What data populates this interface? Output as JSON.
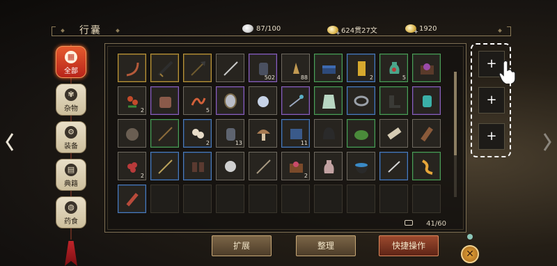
{
  "header": {
    "title": "行囊",
    "resources": [
      {
        "icon": "silver-icon",
        "value": "87/100"
      },
      {
        "icon": "coin-icon",
        "value": "624贯27文"
      },
      {
        "icon": "gold-icon",
        "value": "1920"
      }
    ]
  },
  "tabs": [
    {
      "label": "全部",
      "glyph": "▦",
      "icon": "all-items-icon",
      "active": true
    },
    {
      "label": "杂物",
      "glyph": "✾",
      "icon": "fan-icon",
      "active": false
    },
    {
      "label": "装备",
      "glyph": "⚙",
      "icon": "equipment-icon",
      "active": false
    },
    {
      "label": "典籍",
      "glyph": "▤",
      "icon": "book-icon",
      "active": false
    },
    {
      "label": "药食",
      "glyph": "◍",
      "icon": "food-icon",
      "active": false
    }
  ],
  "inventory": {
    "capacity": "41/60",
    "items": [
      {
        "name": "bow-icon",
        "rarity": "gold",
        "qty": ""
      },
      {
        "name": "saber-icon",
        "rarity": "gold",
        "qty": ""
      },
      {
        "name": "glaive-icon",
        "rarity": "gold",
        "qty": ""
      },
      {
        "name": "sword-icon",
        "rarity": "grey",
        "qty": ""
      },
      {
        "name": "ink-stone-icon",
        "rarity": "purple",
        "qty": "502"
      },
      {
        "name": "bell-icon",
        "rarity": "grey",
        "qty": "88"
      },
      {
        "name": "chest-icon",
        "rarity": "green",
        "qty": "4"
      },
      {
        "name": "gold-tablet-icon",
        "rarity": "blue",
        "qty": "2"
      },
      {
        "name": "vase-icon",
        "rarity": "green",
        "qty": "5"
      },
      {
        "name": "gem-box-icon",
        "rarity": "green",
        "qty": ""
      },
      {
        "name": "herb-flower-icon",
        "rarity": "grey",
        "qty": "2"
      },
      {
        "name": "tree-stump-icon",
        "rarity": "purple",
        "qty": ""
      },
      {
        "name": "worm-icon",
        "rarity": "grey",
        "qty": "5"
      },
      {
        "name": "mirror-icon",
        "rarity": "purple",
        "qty": ""
      },
      {
        "name": "pearl-icon",
        "rarity": "grey",
        "qty": ""
      },
      {
        "name": "hairpin-icon",
        "rarity": "purple",
        "qty": ""
      },
      {
        "name": "robe-icon",
        "rarity": "green",
        "qty": ""
      },
      {
        "name": "bracelet-icon",
        "rarity": "blue",
        "qty": ""
      },
      {
        "name": "boots-icon",
        "rarity": "green",
        "qty": ""
      },
      {
        "name": "jade-bracer-icon",
        "rarity": "purple",
        "qty": ""
      },
      {
        "name": "ore-icon",
        "rarity": "grey",
        "qty": ""
      },
      {
        "name": "staff-icon",
        "rarity": "green",
        "qty": ""
      },
      {
        "name": "buns-icon",
        "rarity": "blue",
        "qty": "2"
      },
      {
        "name": "jar-icon",
        "rarity": "grey",
        "qty": "13"
      },
      {
        "name": "mushroom-icon",
        "rarity": "grey",
        "qty": ""
      },
      {
        "name": "manual-icon",
        "rarity": "blue",
        "qty": "11"
      },
      {
        "name": "helmet-icon",
        "rarity": "grey",
        "qty": ""
      },
      {
        "name": "melon-icon",
        "rarity": "green",
        "qty": ""
      },
      {
        "name": "scroll-icon",
        "rarity": "grey",
        "qty": ""
      },
      {
        "name": "bamboo-tube-icon",
        "rarity": "grey",
        "qty": ""
      },
      {
        "name": "berries-icon",
        "rarity": "grey",
        "qty": "2"
      },
      {
        "name": "spear-icon",
        "rarity": "blue",
        "qty": ""
      },
      {
        "name": "gauntlets-icon",
        "rarity": "blue",
        "qty": ""
      },
      {
        "name": "orb-icon",
        "rarity": "grey",
        "qty": ""
      },
      {
        "name": "lance-icon",
        "rarity": "grey",
        "qty": ""
      },
      {
        "name": "jewel-box-icon",
        "rarity": "grey",
        "qty": "2"
      },
      {
        "name": "potion-icon",
        "rarity": "grey",
        "qty": ""
      },
      {
        "name": "bowl-icon",
        "rarity": "grey",
        "qty": ""
      },
      {
        "name": "dagger-icon",
        "rarity": "blue",
        "qty": ""
      },
      {
        "name": "ginseng-icon",
        "rarity": "green",
        "qty": ""
      },
      {
        "name": "flute-icon",
        "rarity": "blue",
        "qty": ""
      }
    ],
    "empty_slots": 9
  },
  "buttons": {
    "expand": "扩展",
    "sort": "整理",
    "quick": "快捷操作"
  },
  "quick_slots": [
    "+",
    "+",
    "+"
  ],
  "close_label": "✕",
  "colors": {
    "gold": "#b9953c",
    "purple": "#8a63b8",
    "green": "#4f9c58",
    "blue": "#4f7cb8",
    "accent": "#e55a2e"
  }
}
